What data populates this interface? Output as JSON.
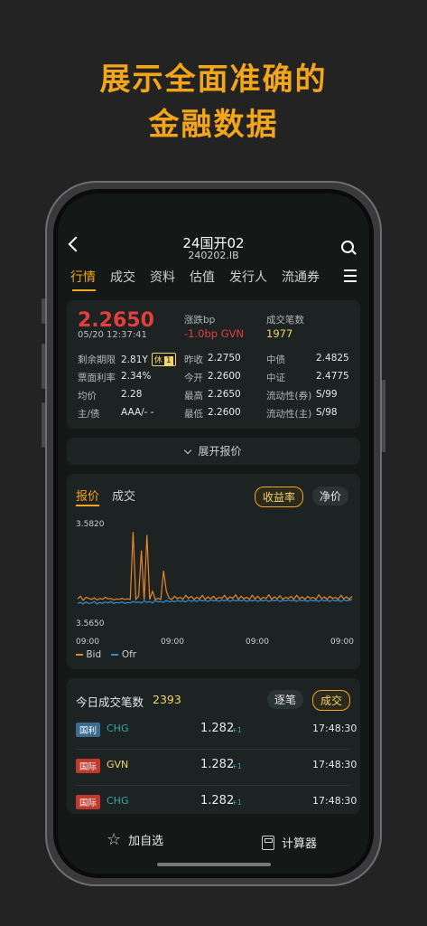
{
  "headline": {
    "line1": "展示全面准确的",
    "line2": "金融数据"
  },
  "navbar": {
    "title": "24国开02",
    "subtitle": "240202.IB"
  },
  "tabs": [
    "行情",
    "成交",
    "资料",
    "估值",
    "发行人",
    "流通券"
  ],
  "quote": {
    "price": "2.2650",
    "time": "05/20 12:37:41",
    "change_label": "涨跌bp",
    "change_value": "-1.0bp GVN",
    "deals_label": "成交笔数",
    "deals_value": "1977",
    "rows": [
      {
        "l1": "剩余期限",
        "v1": "2.81Y",
        "tag": "休",
        "tag_num": "1",
        "l2": "昨收",
        "v2": "2.2750",
        "l3": "中债",
        "v3": "2.4825"
      },
      {
        "l1": "票面利率",
        "v1": "2.34%",
        "l2": "今开",
        "v2": "2.2600",
        "l3": "中证",
        "v3": "2.4775"
      },
      {
        "l1": "均价",
        "v1": "2.28",
        "l2": "最高",
        "v2": "2.2650",
        "l3": "流动性(券)",
        "v3": "S/99"
      },
      {
        "l1": "主/债",
        "v1": "AAA/- -",
        "l2": "最低",
        "v2": "2.2600",
        "l3": "流动性(主)",
        "v3": "S/98"
      }
    ]
  },
  "expand": {
    "label": "展开报价"
  },
  "chart_tabs": [
    "报价",
    "成交"
  ],
  "chart_pills": [
    "收益率",
    "净价"
  ],
  "chart_data": {
    "type": "line",
    "ylabel_top": "3.5820",
    "ylabel_bottom": "3.5650",
    "x_ticks": [
      "09:00",
      "09:00",
      "09:00",
      "09:00"
    ],
    "series": [
      {
        "name": "Bid",
        "color": "#e8862a",
        "values": [
          3.5685,
          3.569,
          3.5682,
          3.5688,
          3.5686,
          3.5684,
          3.5687,
          3.5683,
          3.5686,
          3.5684,
          3.5688,
          3.5685,
          3.5686,
          3.5683,
          3.5685,
          3.5684,
          3.5686,
          3.5684,
          3.5685,
          3.5684,
          3.5816,
          3.5684,
          3.569,
          3.578,
          3.5683,
          3.581,
          3.5684,
          3.57,
          3.5684,
          3.5686,
          3.5684,
          3.574,
          3.57,
          3.5686,
          3.5684,
          3.569,
          3.5685,
          3.5688,
          3.5684,
          3.5692,
          3.5686,
          3.569,
          3.5684,
          3.5688,
          3.5685,
          3.5692,
          3.5684,
          3.5689,
          3.5685,
          3.569,
          3.5684,
          3.5688,
          3.5686,
          3.5692,
          3.5684,
          3.5689,
          3.5686,
          3.5693,
          3.5684,
          3.569,
          3.5685,
          3.5688,
          3.5684,
          3.5692,
          3.5685,
          3.569,
          3.5684,
          3.5688,
          3.5686,
          3.5693,
          3.5684,
          3.5689,
          3.5685,
          3.5691,
          3.5684,
          3.5688,
          3.5686,
          3.569,
          3.5684,
          3.5692,
          3.5685,
          3.5689,
          3.5684,
          3.569,
          3.5686,
          3.5688,
          3.5684,
          3.5693,
          3.5685,
          3.5689,
          3.5684,
          3.569,
          3.5686,
          3.5688,
          3.5684,
          3.5692,
          3.5685,
          3.5689,
          3.5684,
          3.569
        ]
      },
      {
        "name": "Ofr",
        "color": "#2f8fd8",
        "values": [
          3.5676,
          3.5678,
          3.5675,
          3.5679,
          3.5676,
          3.5677,
          3.568,
          3.5675,
          3.5678,
          3.5676,
          3.5679,
          3.5677,
          3.568,
          3.5676,
          3.5678,
          3.5677,
          3.5679,
          3.5676,
          3.5678,
          3.5677,
          3.568,
          3.5678,
          3.5679,
          3.5677,
          3.5681,
          3.5678,
          3.568,
          3.5677,
          3.5682,
          3.5679,
          3.568,
          3.5678,
          3.5682,
          3.5679,
          3.5681,
          3.5679,
          3.5682,
          3.568,
          3.5681,
          3.5679,
          3.5683,
          3.568,
          3.5682,
          3.568,
          3.5683,
          3.5681,
          3.5682,
          3.568,
          3.5683,
          3.5681,
          3.5682,
          3.568,
          3.5683,
          3.5681,
          3.5683,
          3.568,
          3.5683,
          3.5681,
          3.5682,
          3.5681,
          3.5683,
          3.568,
          3.5682,
          3.5681,
          3.5683,
          3.568,
          3.5682,
          3.5681,
          3.5683,
          3.568,
          3.5682,
          3.5681,
          3.5683,
          3.568,
          3.5682,
          3.5681,
          3.5683,
          3.5681,
          3.5682,
          3.568,
          3.5683,
          3.5681,
          3.5682,
          3.568,
          3.5683,
          3.5681,
          3.5682,
          3.568,
          3.5683,
          3.5681,
          3.5682,
          3.568,
          3.5683,
          3.5681,
          3.5682,
          3.568,
          3.5683,
          3.5681,
          3.5682,
          3.5684
        ]
      }
    ],
    "ylim": [
      3.565,
      3.582
    ]
  },
  "trades": {
    "title": "今日成交笔数",
    "count": "2393",
    "pills": [
      "逐笔",
      "成交"
    ],
    "rows": [
      {
        "badge": "国利",
        "badge_color": "blue",
        "type": "CHG",
        "price": "1.282",
        "plus": "+1",
        "time": "17:48:30"
      },
      {
        "badge": "国际",
        "badge_color": "red",
        "type": "GVN",
        "price": "1.282",
        "plus": "+1",
        "time": "17:48:30"
      },
      {
        "badge": "国际",
        "badge_color": "red",
        "type": "CHG",
        "price": "1.282",
        "plus": "+1",
        "time": "17:48:30"
      }
    ]
  },
  "bottom": {
    "watch_label": "加自选",
    "calc_label": "计算器"
  }
}
